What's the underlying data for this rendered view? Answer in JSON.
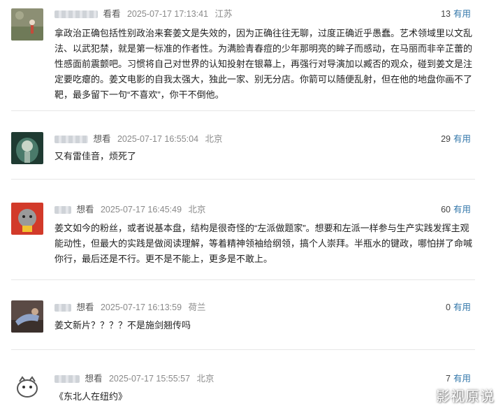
{
  "comments": [
    {
      "status": "看看",
      "time": "2025-07-17 17:13:41",
      "location": "江苏",
      "votes": "13",
      "useful_label": "有用",
      "text": "拿政治正确包括性别政治来套姜文是失效的，因为正确往往无聊，过度正确近乎愚蠢。艺术领域里以文乱法、以武犯禁，就是第一标准的作者性。为满脸青春痘的少年那明亮的眸子而感动，在马丽而非辛芷蕾的性感面前震颤吧。习惯将自己对世界的认知投射在银幕上，再强行对导演加以臧否的观众，碰到姜文是注定要吃瘪的。姜文电影的自我太强大，独此一家、别无分店。你箭可以随便乱射，但在他的地盘你画不了靶，最多留下一句“不喜欢”，你干不倒他。"
    },
    {
      "status": "想看",
      "time": "2025-07-17 16:55:04",
      "location": "北京",
      "votes": "29",
      "useful_label": "有用",
      "text": "又有雷佳音，烦死了"
    },
    {
      "status": "想看",
      "time": "2025-07-17 16:45:49",
      "location": "北京",
      "votes": "60",
      "useful_label": "有用",
      "text": "姜文如今的粉丝，或者说基本盘，结构是很奇怪的“左派做题家”。想要和左派一样参与生产实践发挥主观能动性，但最大的实践是做阅读理解，等着精神领袖给纲领，搞个人崇拜。半瓶水的键政，哪怕拼了命喊你行，最后还是不行。更不是不能上，更多是不敢上。"
    },
    {
      "status": "想看",
      "time": "2025-07-17 16:13:59",
      "location": "荷兰",
      "votes": "0",
      "useful_label": "有用",
      "text": "姜文新片？？？？不是施剑翘传吗"
    },
    {
      "status": "想看",
      "time": "2025-07-17 15:55:57",
      "location": "北京",
      "votes": "7",
      "useful_label": "有用",
      "text": "《东北人在纽约》"
    }
  ],
  "watermark": "影视原说",
  "icons": [
    "avatar-image"
  ]
}
